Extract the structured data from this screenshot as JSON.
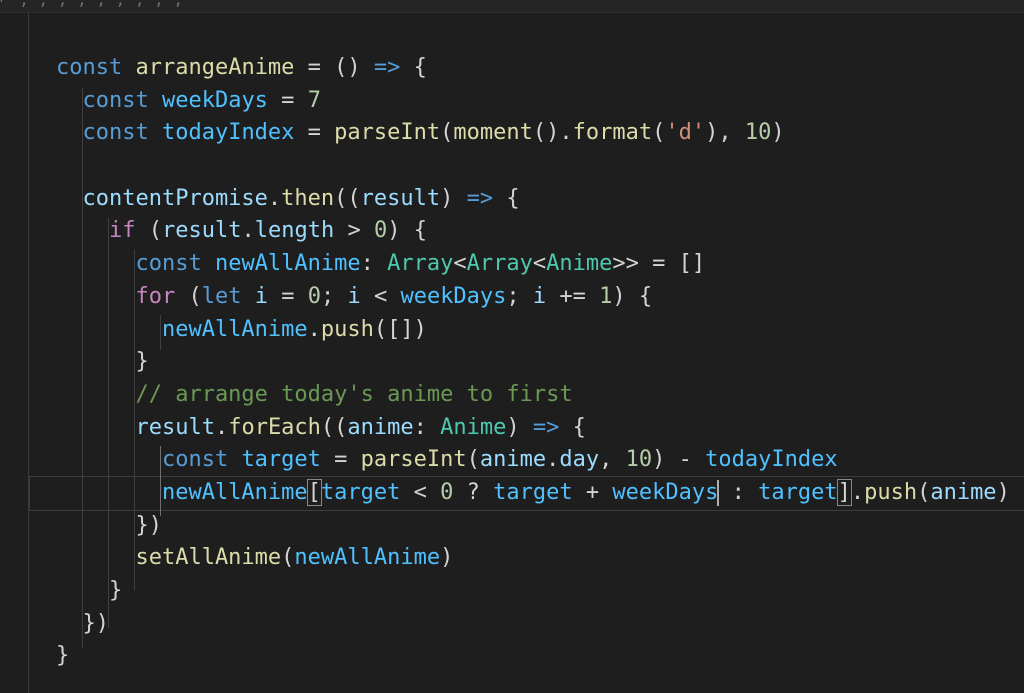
{
  "top_strip": {
    "crumb_text": "  ⌐ ,         ,                       , ,          , , ,            , ,"
  },
  "code_lines": [
    {
      "tokens": [
        {
          "t": "const ",
          "c": "kw"
        },
        {
          "t": "arrangeAnime",
          "c": "fn"
        },
        {
          "t": " = () ",
          "c": "op"
        },
        {
          "t": "=>",
          "c": "kw"
        },
        {
          "t": " {",
          "c": "op"
        }
      ]
    },
    {
      "tokens": [
        {
          "t": "  const ",
          "c": "kw"
        },
        {
          "t": "weekDays",
          "c": "const"
        },
        {
          "t": " = ",
          "c": "op"
        },
        {
          "t": "7",
          "c": "num"
        }
      ]
    },
    {
      "tokens": [
        {
          "t": "  const ",
          "c": "kw"
        },
        {
          "t": "todayIndex",
          "c": "const"
        },
        {
          "t": " = ",
          "c": "op"
        },
        {
          "t": "parseInt",
          "c": "fn"
        },
        {
          "t": "(",
          "c": "op"
        },
        {
          "t": "moment",
          "c": "fn"
        },
        {
          "t": "().",
          "c": "op"
        },
        {
          "t": "format",
          "c": "fn"
        },
        {
          "t": "(",
          "c": "op"
        },
        {
          "t": "'d'",
          "c": "str"
        },
        {
          "t": "), ",
          "c": "op"
        },
        {
          "t": "10",
          "c": "num"
        },
        {
          "t": ")",
          "c": "op"
        }
      ]
    },
    {
      "tokens": [
        {
          "t": "",
          "c": "op"
        }
      ]
    },
    {
      "tokens": [
        {
          "t": "  contentPromise",
          "c": "var"
        },
        {
          "t": ".",
          "c": "op"
        },
        {
          "t": "then",
          "c": "fn"
        },
        {
          "t": "((",
          "c": "op"
        },
        {
          "t": "result",
          "c": "var"
        },
        {
          "t": ") ",
          "c": "op"
        },
        {
          "t": "=>",
          "c": "kw"
        },
        {
          "t": " {",
          "c": "op"
        }
      ]
    },
    {
      "tokens": [
        {
          "t": "    if",
          "c": "ctrl"
        },
        {
          "t": " (",
          "c": "op"
        },
        {
          "t": "result",
          "c": "var"
        },
        {
          "t": ".",
          "c": "op"
        },
        {
          "t": "length",
          "c": "var"
        },
        {
          "t": " > ",
          "c": "op"
        },
        {
          "t": "0",
          "c": "num"
        },
        {
          "t": ") {",
          "c": "op"
        }
      ]
    },
    {
      "tokens": [
        {
          "t": "      const ",
          "c": "kw"
        },
        {
          "t": "newAllAnime",
          "c": "const"
        },
        {
          "t": ": ",
          "c": "op"
        },
        {
          "t": "Array",
          "c": "type"
        },
        {
          "t": "<",
          "c": "op"
        },
        {
          "t": "Array",
          "c": "type"
        },
        {
          "t": "<",
          "c": "op"
        },
        {
          "t": "Anime",
          "c": "type"
        },
        {
          "t": ">> = []",
          "c": "op"
        }
      ]
    },
    {
      "tokens": [
        {
          "t": "      for",
          "c": "ctrl"
        },
        {
          "t": " (",
          "c": "op"
        },
        {
          "t": "let ",
          "c": "kw"
        },
        {
          "t": "i",
          "c": "var"
        },
        {
          "t": " = ",
          "c": "op"
        },
        {
          "t": "0",
          "c": "num"
        },
        {
          "t": "; ",
          "c": "op"
        },
        {
          "t": "i",
          "c": "var"
        },
        {
          "t": " < ",
          "c": "op"
        },
        {
          "t": "weekDays",
          "c": "const"
        },
        {
          "t": "; ",
          "c": "op"
        },
        {
          "t": "i",
          "c": "var"
        },
        {
          "t": " += ",
          "c": "op"
        },
        {
          "t": "1",
          "c": "num"
        },
        {
          "t": ") {",
          "c": "op"
        }
      ]
    },
    {
      "tokens": [
        {
          "t": "        newAllAnime",
          "c": "const"
        },
        {
          "t": ".",
          "c": "op"
        },
        {
          "t": "push",
          "c": "fn"
        },
        {
          "t": "([])",
          "c": "op"
        }
      ]
    },
    {
      "tokens": [
        {
          "t": "      }",
          "c": "op"
        }
      ]
    },
    {
      "tokens": [
        {
          "t": "      // arrange today's anime to first",
          "c": "cmt"
        }
      ]
    },
    {
      "tokens": [
        {
          "t": "      result",
          "c": "var"
        },
        {
          "t": ".",
          "c": "op"
        },
        {
          "t": "forEach",
          "c": "fn"
        },
        {
          "t": "((",
          "c": "op"
        },
        {
          "t": "anime",
          "c": "var"
        },
        {
          "t": ": ",
          "c": "op"
        },
        {
          "t": "Anime",
          "c": "type"
        },
        {
          "t": ") ",
          "c": "op"
        },
        {
          "t": "=>",
          "c": "kw"
        },
        {
          "t": " {",
          "c": "op"
        }
      ]
    },
    {
      "tokens": [
        {
          "t": "        const ",
          "c": "kw"
        },
        {
          "t": "target",
          "c": "const"
        },
        {
          "t": " = ",
          "c": "op"
        },
        {
          "t": "parseInt",
          "c": "fn"
        },
        {
          "t": "(",
          "c": "op"
        },
        {
          "t": "anime",
          "c": "var"
        },
        {
          "t": ".",
          "c": "op"
        },
        {
          "t": "day",
          "c": "var"
        },
        {
          "t": ", ",
          "c": "op"
        },
        {
          "t": "10",
          "c": "num"
        },
        {
          "t": ") - ",
          "c": "op"
        },
        {
          "t": "todayIndex",
          "c": "const"
        }
      ]
    },
    {
      "current": true,
      "tokens": [
        {
          "t": "        newAllAnime",
          "c": "const"
        },
        {
          "t": "[",
          "c": "op",
          "match": true
        },
        {
          "t": "target",
          "c": "const"
        },
        {
          "t": " < ",
          "c": "op"
        },
        {
          "t": "0",
          "c": "num"
        },
        {
          "t": " ? ",
          "c": "op"
        },
        {
          "t": "target",
          "c": "const"
        },
        {
          "t": " + ",
          "c": "op"
        },
        {
          "t": "weekDays",
          "c": "const"
        },
        {
          "t": "",
          "c": "op",
          "cursor": true
        },
        {
          "t": " : ",
          "c": "op"
        },
        {
          "t": "target",
          "c": "const"
        },
        {
          "t": "]",
          "c": "op",
          "match": true
        },
        {
          "t": ".",
          "c": "op"
        },
        {
          "t": "push",
          "c": "fn"
        },
        {
          "t": "(",
          "c": "op"
        },
        {
          "t": "anime",
          "c": "var"
        },
        {
          "t": ")",
          "c": "op"
        }
      ]
    },
    {
      "tokens": [
        {
          "t": "      })",
          "c": "op"
        }
      ]
    },
    {
      "tokens": [
        {
          "t": "      setAllAnime",
          "c": "fn"
        },
        {
          "t": "(",
          "c": "op"
        },
        {
          "t": "newAllAnime",
          "c": "const"
        },
        {
          "t": ")",
          "c": "op"
        }
      ]
    },
    {
      "tokens": [
        {
          "t": "    }",
          "c": "op"
        }
      ]
    },
    {
      "tokens": [
        {
          "t": "  })",
          "c": "op"
        }
      ]
    },
    {
      "tokens": [
        {
          "t": "}",
          "c": "op"
        }
      ]
    }
  ],
  "colors": {
    "background": "#1e1e1e",
    "keyword": "#569cd6",
    "control": "#c586c0",
    "function": "#dcdcaa",
    "variable": "#9cdcfe",
    "constant": "#4fc1ff",
    "type": "#4ec9b0",
    "number": "#b5cea8",
    "string": "#ce9178",
    "comment": "#6a9955"
  }
}
